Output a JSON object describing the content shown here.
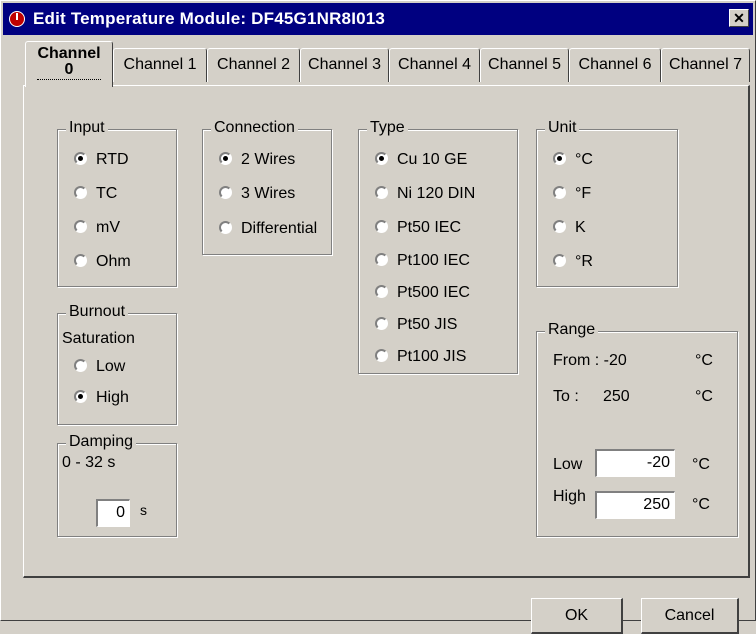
{
  "window": {
    "title": "Edit Temperature Module: DF45G1NR8I013",
    "close_glyph": "✕"
  },
  "tabs": [
    {
      "label": "Channel",
      "number": "0"
    },
    {
      "label": "Channel 1"
    },
    {
      "label": "Channel 2"
    },
    {
      "label": "Channel 3"
    },
    {
      "label": "Channel 4"
    },
    {
      "label": "Channel 5"
    },
    {
      "label": "Channel 6"
    },
    {
      "label": "Channel 7"
    }
  ],
  "input": {
    "legend": "Input",
    "options": [
      "RTD",
      "TC",
      "mV",
      "Ohm"
    ],
    "selected": "RTD"
  },
  "connection": {
    "legend": "Connection",
    "options": [
      "2 Wires",
      "3 Wires",
      "Differential"
    ],
    "selected": "2 Wires"
  },
  "type": {
    "legend": "Type",
    "options": [
      "Cu 10 GE",
      "Ni 120 DIN",
      "Pt50 IEC",
      "Pt100 IEC",
      "Pt500 IEC",
      "Pt50 JIS",
      "Pt100 JIS"
    ],
    "selected": "Cu 10 GE"
  },
  "unit": {
    "legend": "Unit",
    "options": [
      "°C",
      "°F",
      "K",
      "°R"
    ],
    "selected": "°C"
  },
  "burnout": {
    "legend": "Burnout",
    "caption": "Saturation",
    "options": [
      "Low",
      "High"
    ],
    "selected": "High"
  },
  "damping": {
    "legend": "Damping",
    "caption": "0 - 32 s",
    "value": "0",
    "unit": "s"
  },
  "range": {
    "legend": "Range",
    "from_label": "From : -20",
    "from_unit": "°C",
    "to_label": "To :",
    "to_value": "250",
    "to_unit": "°C",
    "low_label": "Low",
    "low_value": "-20",
    "low_unit": "°C",
    "high_label": "High",
    "high_value": "250",
    "high_unit": "°C"
  },
  "buttons": {
    "ok": "OK",
    "cancel": "Cancel"
  },
  "colors": {
    "face": "#d4d0c8",
    "titlebar": "#000080"
  }
}
